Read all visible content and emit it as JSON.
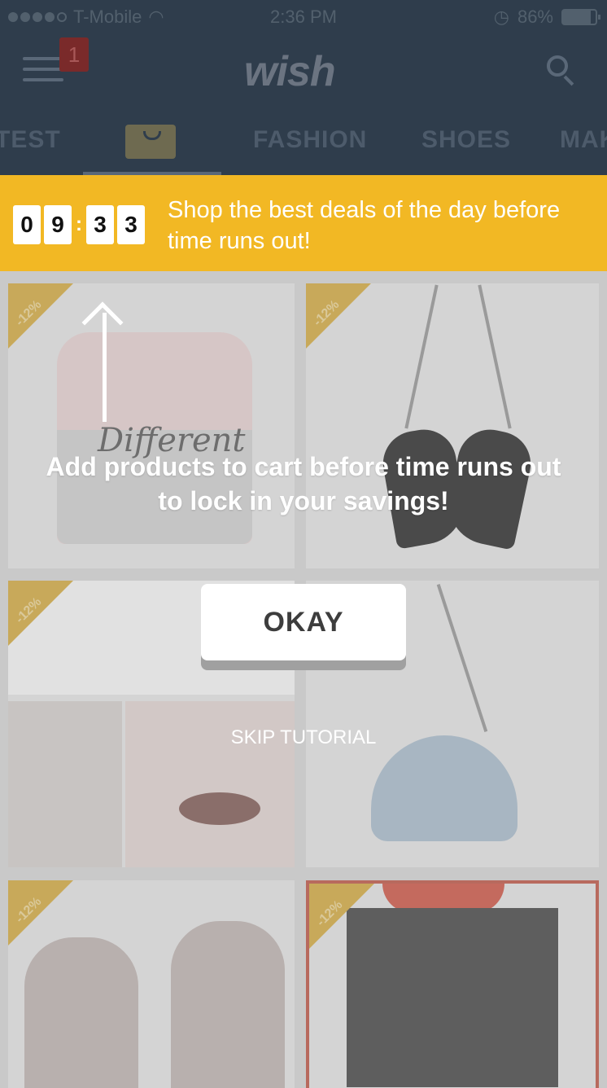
{
  "status_bar": {
    "carrier": "T-Mobile",
    "time": "2:36 PM",
    "battery": "86%",
    "battery_level": 0.86
  },
  "header": {
    "menu_badge": "1",
    "logo": "wish",
    "tabs": [
      "TEST",
      "FASHION",
      "SHOES",
      "MAK"
    ]
  },
  "deal_banner": {
    "digits": [
      "0",
      "9",
      "3",
      "3"
    ],
    "separator": ":",
    "message": "Shop the best deals of the day before time runs out!",
    "background_color": "#f2b824"
  },
  "products": {
    "discount_label": "-12%",
    "sweater_text": "Different"
  },
  "tutorial": {
    "message": "Add products to cart before time runs out to lock in your savings!",
    "okay_label": "OKAY",
    "skip_label": "SKIP TUTORIAL"
  }
}
